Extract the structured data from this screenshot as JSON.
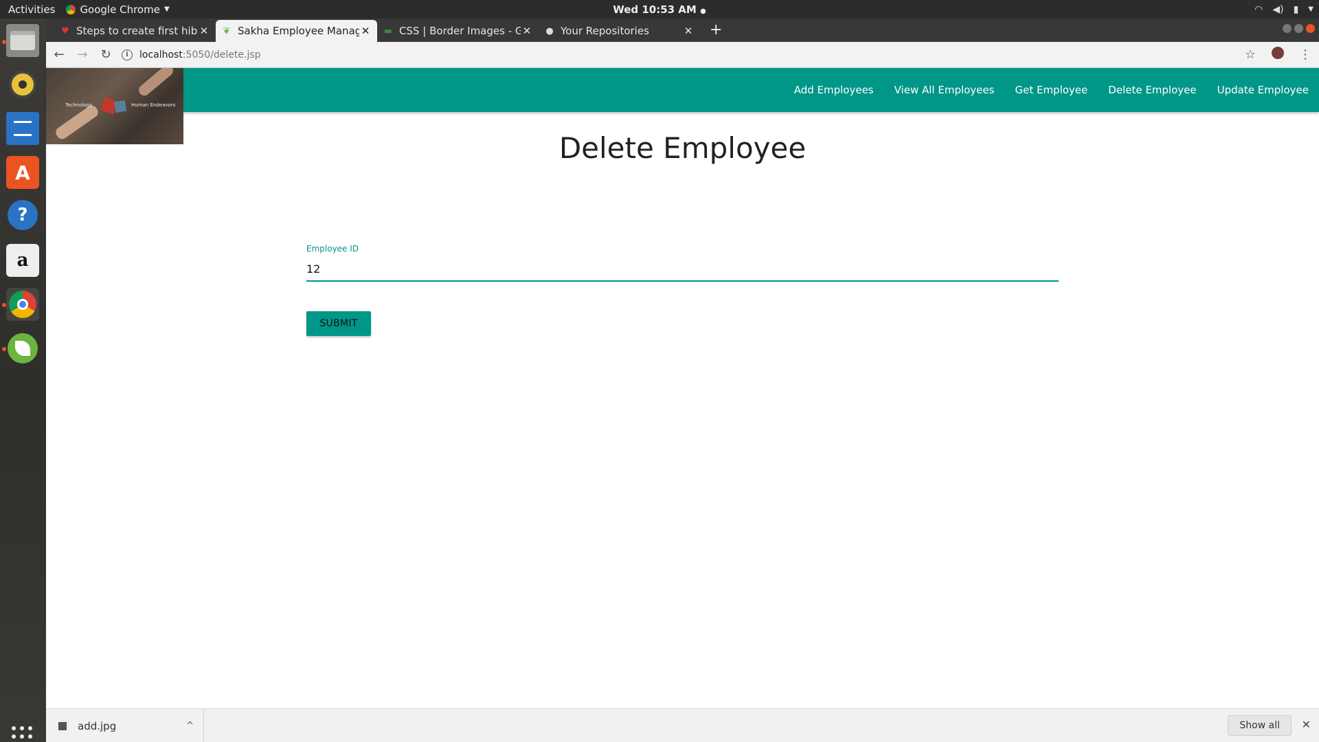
{
  "system": {
    "activities": "Activities",
    "app_name": "Google Chrome",
    "clock": "Wed 10:53 AM"
  },
  "browser": {
    "tabs": [
      {
        "title": "Steps to create first hiber",
        "active": false
      },
      {
        "title": "Sakha Employee Manager",
        "active": true
      },
      {
        "title": "CSS | Border Images - Gee",
        "active": false
      },
      {
        "title": "Your Repositories",
        "active": false
      }
    ],
    "url_host": "localhost",
    "url_path": ":5050/delete.jsp"
  },
  "page": {
    "nav": [
      "Add Employees",
      "View All Employees",
      "Get Employee",
      "Delete Employee",
      "Update Employee"
    ],
    "logo_text_left": "Technology",
    "logo_text_right": "Human Endeavors",
    "heading": "Delete Employee",
    "field_label": "Employee ID",
    "field_value": "12",
    "submit_label": "SUBMIT"
  },
  "downloads": {
    "file": "add.jpg",
    "show_all": "Show all"
  },
  "colors": {
    "accent": "#009688",
    "topbar": "#2c2c2a"
  }
}
